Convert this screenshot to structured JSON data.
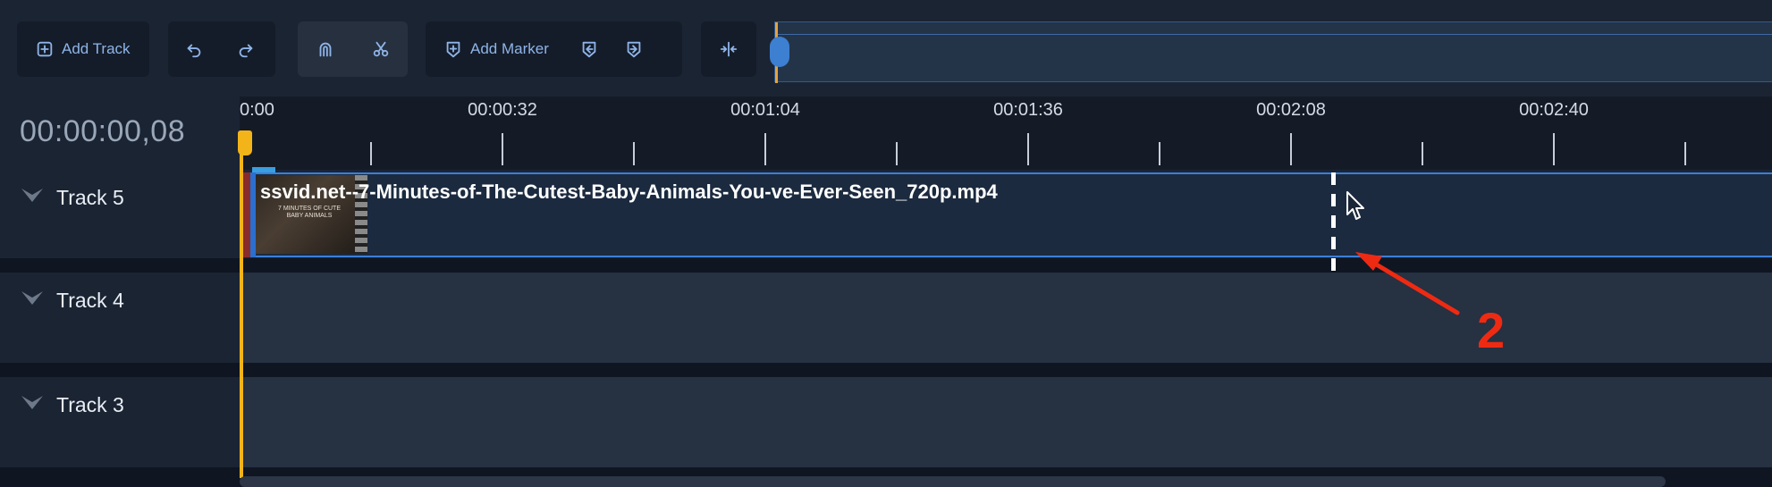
{
  "toolbar": {
    "add_track_label": "Add Track",
    "add_marker_label": "Add Marker"
  },
  "timecode": "00:00:00,08",
  "ruler": {
    "labels": [
      "0:00",
      "00:00:32",
      "00:01:04",
      "00:01:36",
      "00:02:08",
      "00:02:40"
    ]
  },
  "tracks": [
    {
      "name": "Track 5"
    },
    {
      "name": "Track 4"
    },
    {
      "name": "Track 3"
    }
  ],
  "clip": {
    "title": "ssvid.net--7-Minutes-of-The-Cutest-Baby-Animals-You-ve-Ever-Seen_720p.mp4",
    "thumbnail_text": "7 MINUTES OF CUTE BABY ANIMALS"
  },
  "annotation": {
    "number": "2",
    "color": "#ee2a12"
  },
  "colors": {
    "accent": "#8fb4e8",
    "playhead": "#f2b418",
    "clip_border": "#3b7fd8"
  }
}
